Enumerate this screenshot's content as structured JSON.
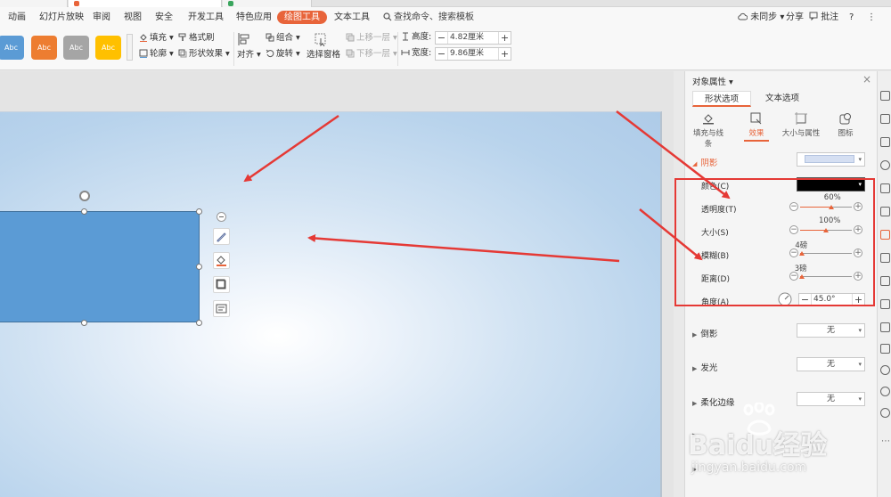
{
  "menubar": {
    "items": [
      "动画",
      "幻灯片放映",
      "审阅",
      "视图",
      "安全",
      "开发工具",
      "特色应用",
      "绘图工具",
      "文本工具"
    ],
    "active_item": "绘图工具",
    "search": "查找命令、搜索模板",
    "sync": "未同步",
    "share": "分享",
    "comment": "批注",
    "help": "?"
  },
  "ribbon": {
    "styles": [
      {
        "label": "Abc",
        "color": "#5b9bd5"
      },
      {
        "label": "Abc",
        "color": "#ed7d31"
      },
      {
        "label": "Abc",
        "color": "#a5a5a5"
      },
      {
        "label": "Abc",
        "color": "#ffc000"
      }
    ],
    "fill": "填充",
    "format_painter": "格式刷",
    "outline": "轮廓",
    "shape_effect": "形状效果",
    "align": "对齐",
    "group": "组合",
    "rotate": "旋转",
    "selection_pane": "选择窗格",
    "bring_forward": "上移一层",
    "send_backward": "下移一层",
    "height_label": "高度:",
    "height_value": "4.82厘米",
    "width_label": "宽度:",
    "width_value": "9.86厘米"
  },
  "pane": {
    "title": "对象属性",
    "tabs": [
      "形状选项",
      "文本选项"
    ],
    "subtabs": [
      "填充与线条",
      "效果",
      "大小与属性",
      "图标"
    ],
    "shadow": {
      "label": "阴影",
      "color_label": "颜色(C)",
      "props": [
        {
          "label": "透明度(T)",
          "value": "60%",
          "fraction": 0.6
        },
        {
          "label": "大小(S)",
          "value": "100%",
          "fraction": 0.5
        },
        {
          "label": "模糊(B)",
          "value": "4磅",
          "fraction": 0.04
        },
        {
          "label": "距离(D)",
          "value": "3磅",
          "fraction": 0.03
        }
      ],
      "angle_label": "角度(A)",
      "angle_value": "45.0°"
    },
    "sections": [
      {
        "label": "倒影",
        "value": "无"
      },
      {
        "label": "发光",
        "value": "无"
      },
      {
        "label": "柔化边缘",
        "value": "无"
      }
    ]
  },
  "watermark": {
    "brand": "Baidu经验",
    "url": "jingyan.baidu.com"
  },
  "colors": {
    "accent": "#e8643a",
    "shape_fill": "#5b9bd5",
    "annotation": "#e53935"
  }
}
